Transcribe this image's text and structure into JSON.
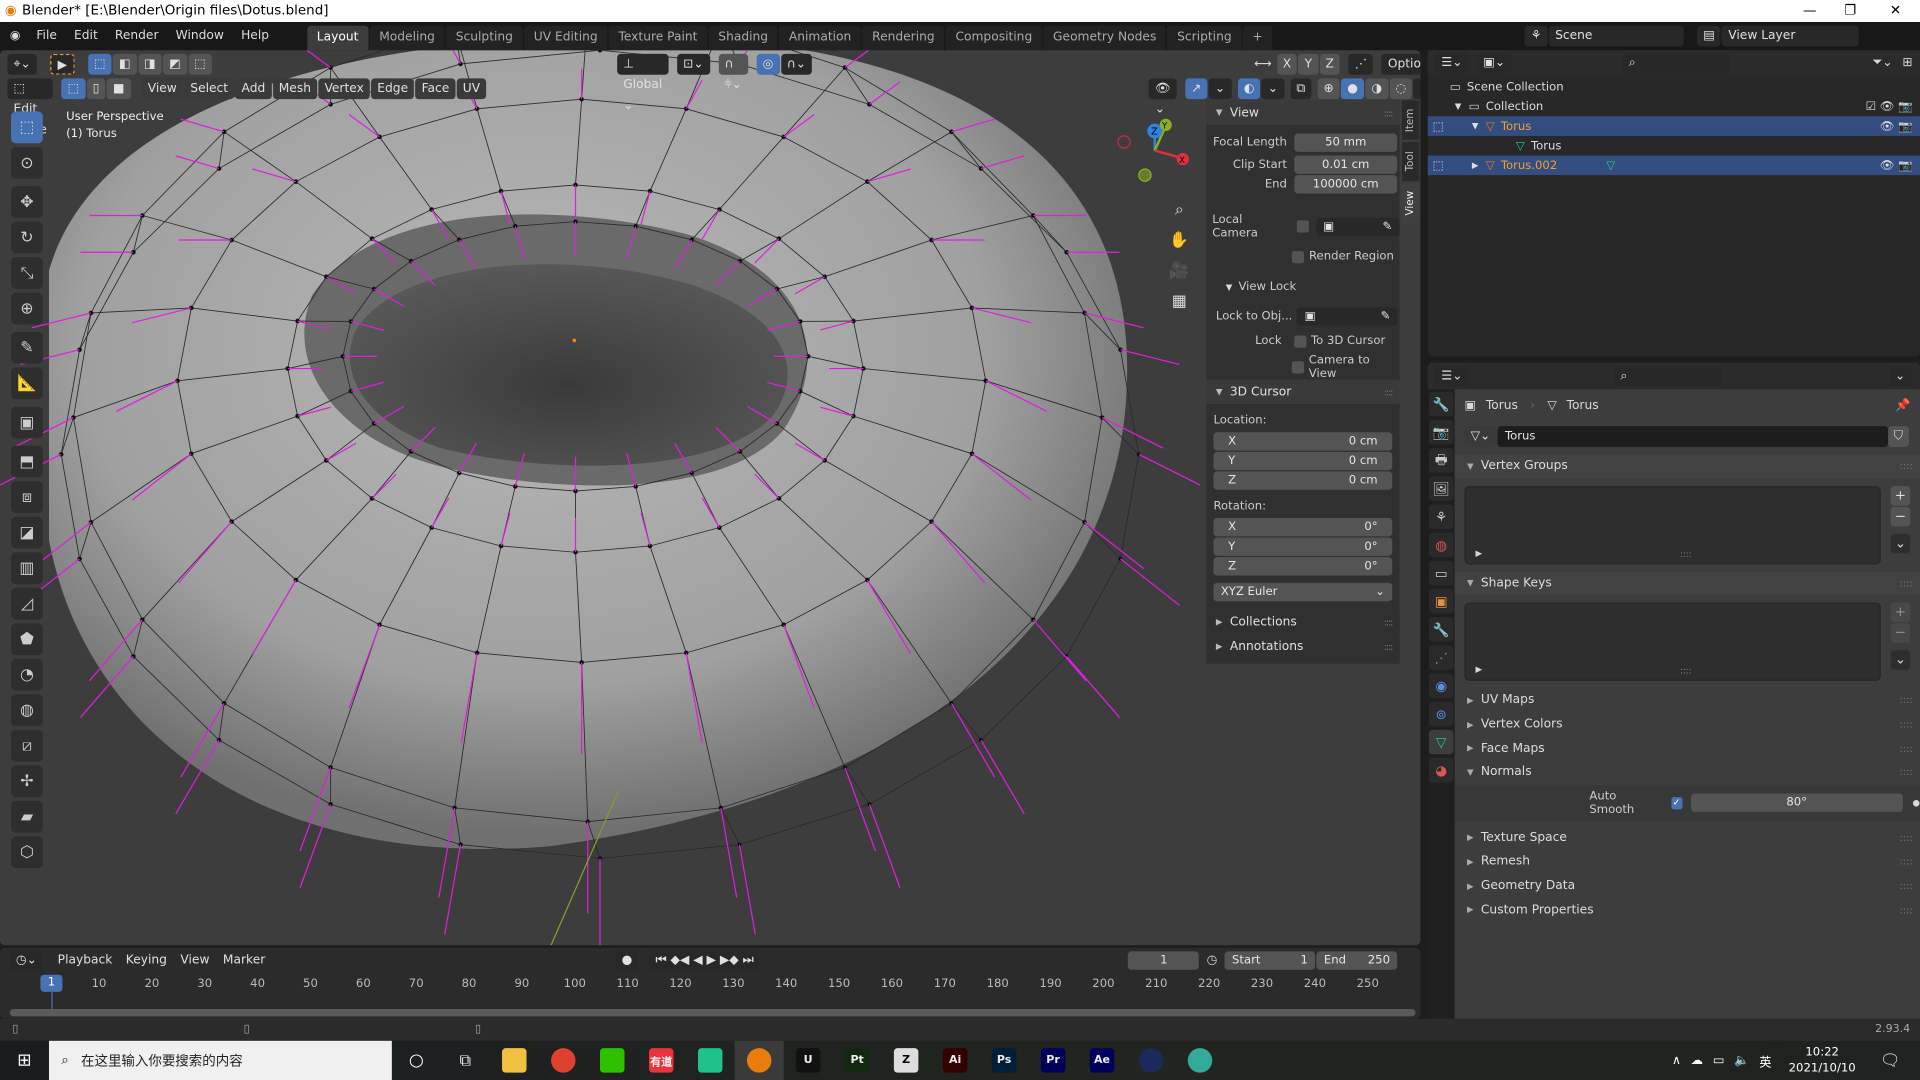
{
  "window": {
    "title": "Blender* [E:\\Blender\\Origin files\\Dotus.blend]",
    "min": "—",
    "max": "❐",
    "close": "✕"
  },
  "menu": [
    "File",
    "Edit",
    "Render",
    "Window",
    "Help"
  ],
  "workspaces": [
    "Layout",
    "Modeling",
    "Sculpting",
    "UV Editing",
    "Texture Paint",
    "Shading",
    "Animation",
    "Rendering",
    "Compositing",
    "Geometry Nodes",
    "Scripting"
  ],
  "scene": {
    "scene_name": "Scene",
    "view_layer": "View Layer"
  },
  "tool_header": {
    "orientation": "Global",
    "axis": [
      "X",
      "Y",
      "Z"
    ],
    "options": "Options"
  },
  "viewport_header": {
    "mode": "Edit Mode",
    "menus": [
      "View",
      "Select",
      "Add",
      "Mesh",
      "Vertex",
      "Edge",
      "Face",
      "UV"
    ]
  },
  "viewport": {
    "perspective": "User Perspective",
    "object": "(1) Torus",
    "gizmo": {
      "x": "X",
      "y": "Y",
      "z": "Z"
    }
  },
  "npanel": {
    "tabs": [
      "Item",
      "Tool",
      "View"
    ],
    "active_tab": "View",
    "view": {
      "title": "View",
      "focal_length_label": "Focal Length",
      "focal_length": "50 mm",
      "clip_start_label": "Clip Start",
      "clip_start": "0.01 cm",
      "end_label": "End",
      "clip_end": "100000 cm",
      "local_camera": "Local Camera",
      "render_region": "Render Region"
    },
    "view_lock": {
      "title": "View Lock",
      "lock_to_obj": "Lock to Obj...",
      "lock": "Lock",
      "to_3d_cursor": "To 3D Cursor",
      "camera_to_view": "Camera to View"
    },
    "cursor": {
      "title": "3D Cursor",
      "location": "Location:",
      "loc": [
        {
          "axis": "X",
          "value": "0 cm"
        },
        {
          "axis": "Y",
          "value": "0 cm"
        },
        {
          "axis": "Z",
          "value": "0 cm"
        }
      ],
      "rotation": "Rotation:",
      "rot": [
        {
          "axis": "X",
          "value": "0°"
        },
        {
          "axis": "Y",
          "value": "0°"
        },
        {
          "axis": "Z",
          "value": "0°"
        }
      ],
      "mode": "XYZ Euler"
    },
    "collections": "Collections",
    "annotations": "Annotations"
  },
  "outliner": {
    "scene_collection": "Scene Collection",
    "collection": "Collection",
    "items": [
      {
        "name": "Torus",
        "mesh": "Torus"
      },
      {
        "name": "Torus.002"
      }
    ]
  },
  "properties": {
    "breadcrumb": [
      "Torus",
      "Torus"
    ],
    "mesh_name": "Torus",
    "sections": {
      "vertex_groups": "Vertex Groups",
      "shape_keys": "Shape Keys",
      "uv_maps": "UV Maps",
      "vertex_colors": "Vertex Colors",
      "face_maps": "Face Maps",
      "normals": "Normals",
      "texture_space": "Texture Space",
      "remesh": "Remesh",
      "geometry_data": "Geometry Data",
      "custom_properties": "Custom Properties"
    },
    "auto_smooth_label": "Auto Smooth",
    "auto_smooth": true,
    "auto_smooth_angle": "80°"
  },
  "timeline": {
    "menus": [
      "Playback",
      "Keying",
      "View",
      "Marker"
    ],
    "current_frame": "1",
    "start_label": "Start",
    "start": "1",
    "end_label": "End",
    "end": "250",
    "ticks": [
      "10",
      "20",
      "30",
      "40",
      "50",
      "60",
      "70",
      "80",
      "90",
      "100",
      "110",
      "120",
      "130",
      "140",
      "150",
      "160",
      "170",
      "180",
      "190",
      "200",
      "210",
      "220",
      "230",
      "240",
      "250"
    ]
  },
  "status": {
    "version": "2.93.4"
  },
  "taskbar": {
    "search_placeholder": "在这里输入你要搜索的内容",
    "apps": [
      {
        "name": "file-explorer",
        "label": "",
        "color": "#f0c040"
      },
      {
        "name": "chrome",
        "label": "",
        "color": "#e04030"
      },
      {
        "name": "wechat",
        "label": "",
        "color": "#2dc100"
      },
      {
        "name": "youdao",
        "label": "有道",
        "color": "#e8323c"
      },
      {
        "name": "app-green",
        "label": "",
        "color": "#1fc28a"
      },
      {
        "name": "blender",
        "label": "",
        "color": "#e87d0d"
      },
      {
        "name": "unreal",
        "label": "U",
        "color": "#111"
      },
      {
        "name": "painter",
        "label": "Pt",
        "color": "#10290f"
      },
      {
        "name": "zbrush",
        "label": "Z",
        "color": "#ddd"
      },
      {
        "name": "illustrator",
        "label": "Ai",
        "color": "#330000"
      },
      {
        "name": "photoshop",
        "label": "Ps",
        "color": "#001e36"
      },
      {
        "name": "premiere",
        "label": "Pr",
        "color": "#00005b"
      },
      {
        "name": "after-effects",
        "label": "Ae",
        "color": "#00005b"
      },
      {
        "name": "cinema4d",
        "label": "",
        "color": "#1b2a5a"
      },
      {
        "name": "app-globe",
        "label": "",
        "color": "#3a9"
      }
    ],
    "ime": "英",
    "time": "10:22",
    "date": "2021/10/10"
  },
  "colors": {
    "accent": "#4772b3",
    "normals": "#e01ee0",
    "selected_object": "#f0a030",
    "mesh_data": "#22cc88"
  }
}
